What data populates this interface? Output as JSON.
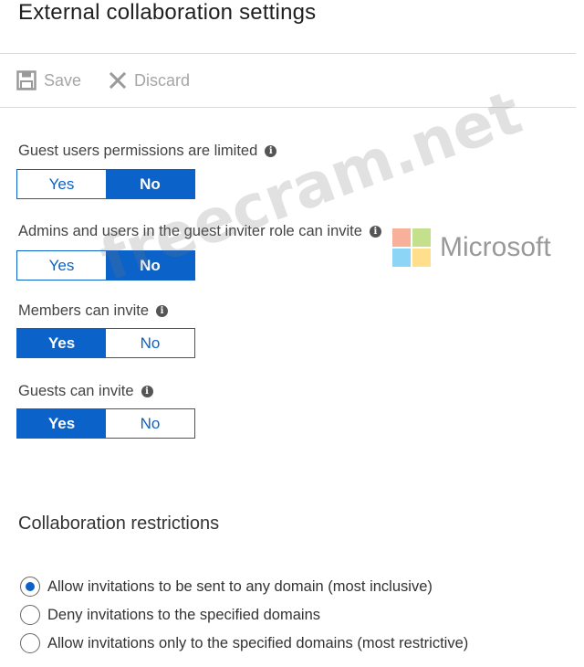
{
  "page": {
    "title": "External collaboration settings"
  },
  "toolbar": {
    "save_label": "Save",
    "discard_label": "Discard"
  },
  "settings": [
    {
      "label": "Guest users permissions are limited",
      "yes": "Yes",
      "no": "No",
      "selected": "No"
    },
    {
      "label": "Admins and users in the guest inviter role can invite",
      "yes": "Yes",
      "no": "No",
      "selected": "No"
    },
    {
      "label": "Members can invite",
      "yes": "Yes",
      "no": "No",
      "selected": "Yes"
    },
    {
      "label": "Guests can invite",
      "yes": "Yes",
      "no": "No",
      "selected": "Yes"
    }
  ],
  "restrictions": {
    "title": "Collaboration restrictions",
    "options": [
      {
        "label": "Allow invitations to be sent to any domain (most inclusive)",
        "checked": true
      },
      {
        "label": "Deny invitations to the specified domains",
        "checked": false
      },
      {
        "label": "Allow invitations only to the specified domains (most restrictive)",
        "checked": false
      }
    ]
  },
  "watermark": {
    "site": "freecram.net",
    "brand": "Microsoft"
  },
  "colors": {
    "accent": "#0b62c9",
    "ms_red": "#f25022",
    "ms_green": "#7fba00",
    "ms_blue": "#00a4ef",
    "ms_yellow": "#ffb900"
  }
}
